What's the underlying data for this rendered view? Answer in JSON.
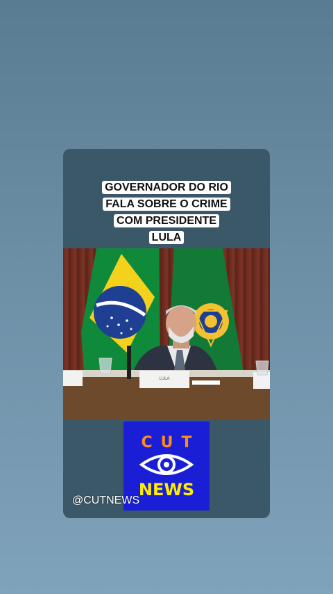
{
  "video": {
    "caption_lines": [
      "GOVERNADOR DO RIO",
      "FALA SOBRE O CRIME",
      "COM PRESIDENTE",
      "LULA"
    ],
    "handle": "@CUTNEWS",
    "nameplate": "LULA"
  },
  "logo": {
    "top_text": "CUT",
    "bottom_text": "NEWS",
    "icon": "eye-icon",
    "colors": {
      "background": "#1a1fd6",
      "top_text": "#ff8a1e",
      "bottom_text": "#ffee00",
      "eye": "#ffffff"
    }
  },
  "colors": {
    "card_background": "#3b5868",
    "page_background": "#6d8fa6"
  }
}
